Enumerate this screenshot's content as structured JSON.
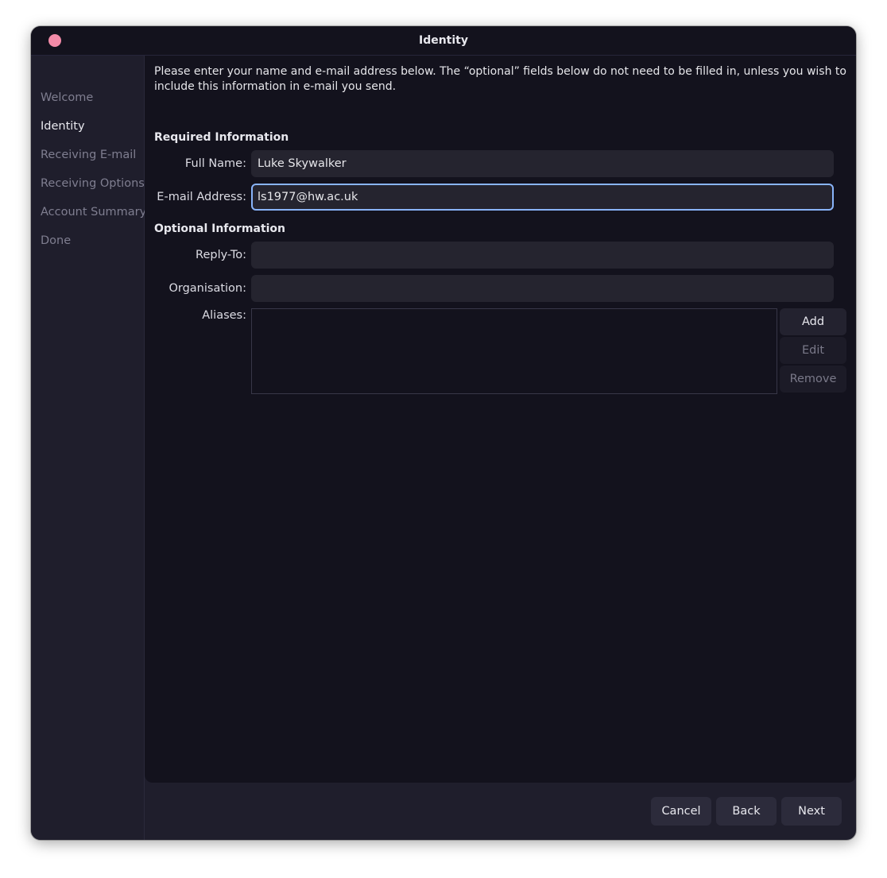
{
  "window": {
    "title": "Identity"
  },
  "sidebar": {
    "items": [
      {
        "label": "Welcome"
      },
      {
        "label": "Identity"
      },
      {
        "label": "Receiving E-mail"
      },
      {
        "label": "Receiving Options"
      },
      {
        "label": "Account Summary"
      },
      {
        "label": "Done"
      }
    ],
    "active": "Identity"
  },
  "intro": {
    "text": "Please enter your name and e-mail address below. The “optional” fields below do not need to be filled in, unless you wish to include this information in e-mail you send."
  },
  "required": {
    "header": "Required Information",
    "full_name_label": "Full Name:",
    "full_name_value": "Luke Skywalker",
    "email_label": "E-mail Address:",
    "email_value": "ls1977@hw.ac.uk"
  },
  "optional": {
    "header": "Optional Information",
    "reply_to_label": "Reply-To:",
    "reply_to_value": "",
    "organisation_label": "Organisation:",
    "organisation_value": "",
    "aliases_label": "Aliases:",
    "add_label": "Add",
    "edit_label": "Edit",
    "remove_label": "Remove"
  },
  "footer": {
    "cancel_label": "Cancel",
    "back_label": "Back",
    "next_label": "Next"
  },
  "colors": {
    "accent_focus": "#89b4fa",
    "close_button": "#f38ba8",
    "background": "#13121d",
    "sidebar": "#1f1e2c"
  }
}
